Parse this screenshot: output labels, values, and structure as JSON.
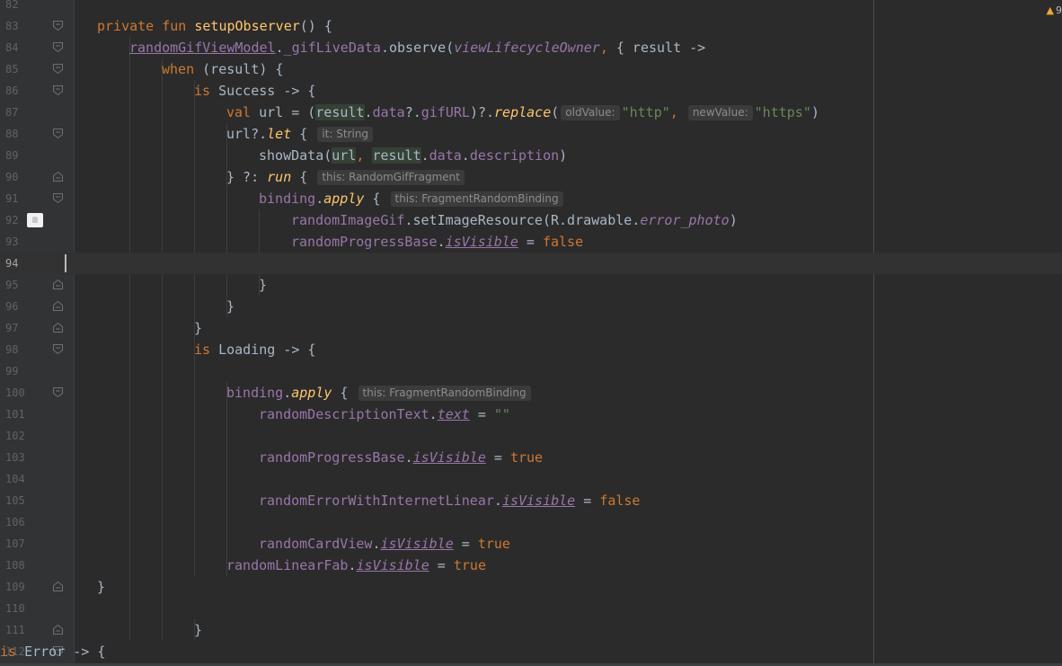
{
  "inspection": {
    "count": "9",
    "icon": "warning-icon",
    "color": "#f0a732"
  },
  "colors": {
    "keyword": "#cc7832",
    "function": "#ffc66d",
    "property": "#9876aa",
    "string": "#6a8759",
    "text": "#a9b7c6"
  },
  "lines": [
    {
      "n": "82"
    },
    {
      "n": "83",
      "fold": "open",
      "t": [
        {
          "c": "kw",
          "x": "private fun "
        },
        {
          "c": "fn",
          "x": "setupObserver"
        },
        {
          "c": "pl",
          "x": "() {"
        }
      ]
    },
    {
      "n": "84",
      "fold": "open",
      "t": [
        {
          "c": "prop-ul",
          "x": "randomGifViewModel"
        },
        {
          "c": "pl",
          "x": "."
        },
        {
          "c": "prop",
          "x": "_gifLiveData"
        },
        {
          "c": "pl",
          "x": ".observe("
        },
        {
          "c": "pi",
          "x": "viewLifecycleOwner"
        },
        {
          "c": "kw",
          "x": ","
        },
        {
          "c": "pl",
          "x": " { result ->"
        }
      ]
    },
    {
      "n": "85",
      "fold": "open",
      "t": [
        {
          "c": "kw",
          "x": "when "
        },
        {
          "c": "pl",
          "x": "(result) {"
        }
      ]
    },
    {
      "n": "86",
      "fold": "open",
      "t": [
        {
          "c": "kw",
          "x": "is "
        },
        {
          "c": "pl",
          "x": "Success -> {"
        }
      ]
    },
    {
      "n": "87",
      "t": [
        {
          "c": "kw",
          "x": "val "
        },
        {
          "c": "pl",
          "x": "url = ("
        },
        {
          "c": "pl smart",
          "x": "result"
        },
        {
          "c": "pl",
          "x": "."
        },
        {
          "c": "prop",
          "x": "data"
        },
        {
          "c": "pl",
          "x": "?."
        },
        {
          "c": "prop",
          "x": "gifURL"
        },
        {
          "c": "pl",
          "x": ")?."
        },
        {
          "c": "fi",
          "x": "replace"
        },
        {
          "c": "pl",
          "x": "("
        },
        {
          "c": "hint",
          "x": "oldValue:"
        },
        {
          "c": "str",
          "x": "\"http\""
        },
        {
          "c": "kw",
          "x": ", "
        },
        {
          "c": "hint",
          "x": "newValue:"
        },
        {
          "c": "str",
          "x": "\"https\""
        },
        {
          "c": "pl",
          "x": ")"
        }
      ]
    },
    {
      "n": "88",
      "fold": "open",
      "t": [
        {
          "c": "pl",
          "x": "url?."
        },
        {
          "c": "fi",
          "x": "let"
        },
        {
          "c": "pl",
          "x": " { "
        },
        {
          "c": "hint",
          "x": "it: String"
        }
      ]
    },
    {
      "n": "89",
      "t": [
        {
          "c": "pl",
          "x": "showData("
        },
        {
          "c": "pl smart",
          "x": "url"
        },
        {
          "c": "kw",
          "x": ", "
        },
        {
          "c": "pl smart",
          "x": "result"
        },
        {
          "c": "pl",
          "x": "."
        },
        {
          "c": "prop",
          "x": "data"
        },
        {
          "c": "pl",
          "x": "."
        },
        {
          "c": "prop",
          "x": "description"
        },
        {
          "c": "pl",
          "x": ")"
        }
      ]
    },
    {
      "n": "90",
      "fold": "close",
      "t": [
        {
          "c": "pl",
          "x": "} ?: "
        },
        {
          "c": "fi",
          "x": "run"
        },
        {
          "c": "pl",
          "x": " { "
        },
        {
          "c": "hint",
          "x": "this: RandomGifFragment"
        }
      ]
    },
    {
      "n": "91",
      "fold": "open",
      "t": [
        {
          "c": "prop",
          "x": "binding"
        },
        {
          "c": "pl",
          "x": "."
        },
        {
          "c": "fi",
          "x": "apply"
        },
        {
          "c": "pl",
          "x": " { "
        },
        {
          "c": "hint",
          "x": "this: FragmentRandomBinding"
        }
      ]
    },
    {
      "n": "92",
      "marker": true,
      "t": [
        {
          "c": "prop",
          "x": "randomImageGif"
        },
        {
          "c": "pl",
          "x": ".setImageResource(R.drawable."
        },
        {
          "c": "pi",
          "x": "error_photo"
        },
        {
          "c": "pl",
          "x": ")"
        }
      ]
    },
    {
      "n": "93",
      "t": [
        {
          "c": "prop",
          "x": "randomProgressBase"
        },
        {
          "c": "pl",
          "x": "."
        },
        {
          "c": "prop-iu",
          "x": "isVisible"
        },
        {
          "c": "pl",
          "x": " = "
        },
        {
          "c": "kw",
          "x": "false"
        }
      ]
    },
    {
      "n": "94",
      "current": true
    },
    {
      "n": "95",
      "fold": "close",
      "t": [
        {
          "c": "pl",
          "x": "}"
        }
      ]
    },
    {
      "n": "96",
      "fold": "close",
      "t": [
        {
          "c": "pl",
          "x": "}"
        }
      ]
    },
    {
      "n": "97",
      "fold": "close",
      "t": [
        {
          "c": "pl",
          "x": "}"
        }
      ]
    },
    {
      "n": "98",
      "fold": "open",
      "t": [
        {
          "c": "kw",
          "x": "is "
        },
        {
          "c": "pl",
          "x": "Loading -> {"
        }
      ]
    },
    {
      "n": "99"
    },
    {
      "n": "100",
      "fold": "open",
      "t": [
        {
          "c": "prop",
          "x": "binding"
        },
        {
          "c": "pl",
          "x": "."
        },
        {
          "c": "fi",
          "x": "apply"
        },
        {
          "c": "pl",
          "x": " { "
        },
        {
          "c": "hint",
          "x": "this: FragmentRandomBinding"
        }
      ]
    },
    {
      "n": "101",
      "t": [
        {
          "c": "prop",
          "x": "randomDescriptionText"
        },
        {
          "c": "pl",
          "x": "."
        },
        {
          "c": "prop-iu",
          "x": "text"
        },
        {
          "c": "pl",
          "x": " = "
        },
        {
          "c": "str",
          "x": "\"\""
        }
      ]
    },
    {
      "n": "102"
    },
    {
      "n": "103",
      "t": [
        {
          "c": "prop",
          "x": "randomProgressBase"
        },
        {
          "c": "pl",
          "x": "."
        },
        {
          "c": "prop-iu",
          "x": "isVisible"
        },
        {
          "c": "pl",
          "x": " = "
        },
        {
          "c": "kw",
          "x": "true"
        }
      ]
    },
    {
      "n": "104"
    },
    {
      "n": "105",
      "t": [
        {
          "c": "prop",
          "x": "randomErrorWithInternetLinear"
        },
        {
          "c": "pl",
          "x": "."
        },
        {
          "c": "prop-iu",
          "x": "isVisible"
        },
        {
          "c": "pl",
          "x": " = "
        },
        {
          "c": "kw",
          "x": "false"
        }
      ]
    },
    {
      "n": "106"
    },
    {
      "n": "107",
      "t": [
        {
          "c": "prop",
          "x": "randomCardView"
        },
        {
          "c": "pl",
          "x": "."
        },
        {
          "c": "prop-iu",
          "x": "isVisible"
        },
        {
          "c": "pl",
          "x": " = "
        },
        {
          "c": "kw",
          "x": "true"
        }
      ]
    },
    {
      "n": "108",
      "t": [
        {
          "c": "prop",
          "x": "randomLinearFab"
        },
        {
          "c": "pl",
          "x": "."
        },
        {
          "c": "prop-iu",
          "x": "isVisible"
        },
        {
          "c": "pl",
          "x": " = "
        },
        {
          "c": "kw",
          "x": "true"
        }
      ]
    },
    {
      "n": "109",
      "fold": "close",
      "t": [
        {
          "c": "pl",
          "x": "}"
        }
      ]
    },
    {
      "n": "110"
    },
    {
      "n": "111",
      "fold": "close",
      "t": [
        {
          "c": "pl",
          "x": "}"
        }
      ]
    },
    {
      "n": "112",
      "fold": "open",
      "t": [
        {
          "c": "kw",
          "x": "is "
        },
        {
          "c": "pl",
          "x": "Error -> {"
        }
      ]
    }
  ]
}
